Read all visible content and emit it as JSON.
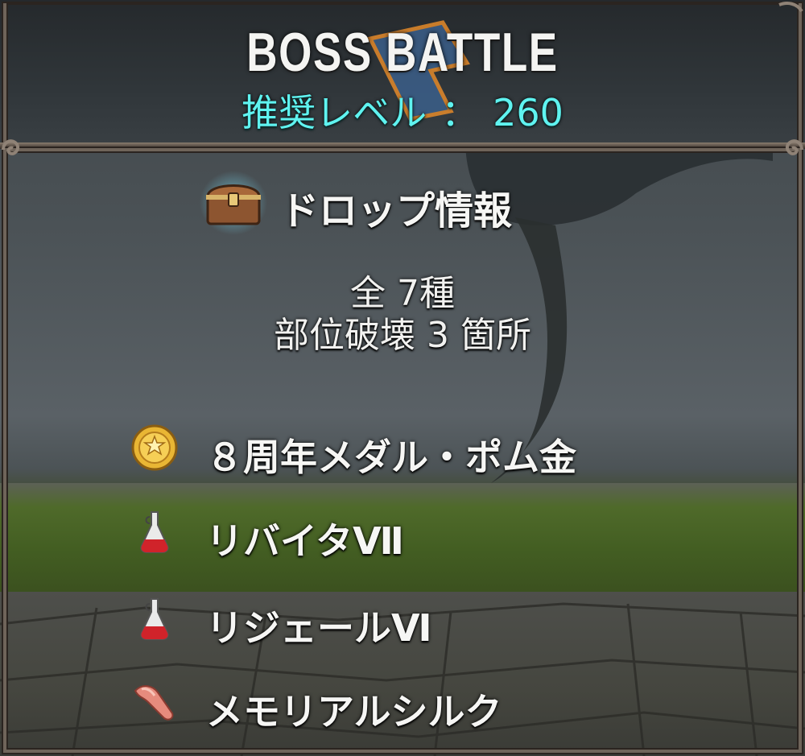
{
  "header": {
    "title": "BOSS BATTLE",
    "level_label": "推奨レベル",
    "level_separator": "：",
    "level_value": "260"
  },
  "drop_info": {
    "icon": "treasure-chest-icon",
    "title": "ドロップ情報",
    "total": "全 7種",
    "part_break": "部位破壊 3 箇所"
  },
  "items": [
    {
      "icon": "gold-medal-icon",
      "name": "８周年メダル・ポム金"
    },
    {
      "icon": "red-potion-icon",
      "name": "リバイタⅦ"
    },
    {
      "icon": "red-potion-icon",
      "name": "リジェールⅥ"
    },
    {
      "icon": "silk-cloth-icon",
      "name": "メモリアルシルク"
    }
  ],
  "colors": {
    "title": "#f4f4f2",
    "level": "#5ff3f0",
    "frame": "#6f645a"
  }
}
